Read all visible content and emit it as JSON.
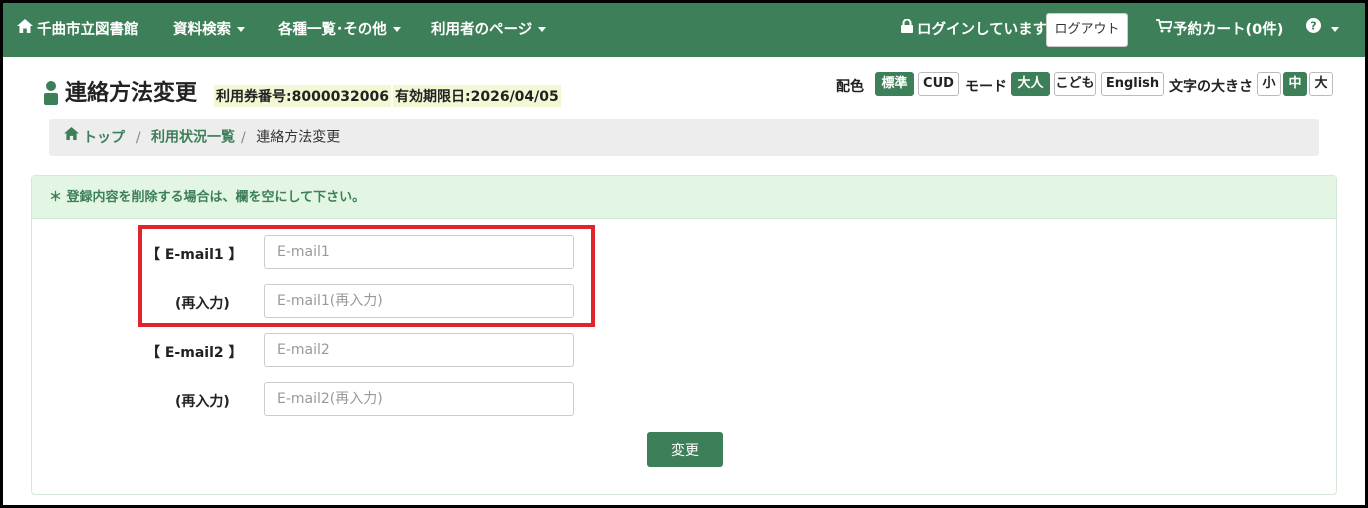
{
  "navbar": {
    "site_name": "千曲市立図書館",
    "menu": [
      "資料検索",
      "各種一覧･その他",
      "利用者のページ"
    ],
    "login_status": "ログインしています",
    "logout_label": "ログアウト",
    "cart_label": "予約カート(0件)",
    "help_icon": "question-circle-icon"
  },
  "header": {
    "title": "連絡方法変更",
    "card_number": "利用券番号:8000032006",
    "expiry": "有効期限日:2026/04/05"
  },
  "toolbar": {
    "color_label": "配色",
    "color_options": [
      "標準",
      "CUD"
    ],
    "mode_label": "モード",
    "mode_options": [
      "大人",
      "こども",
      "English"
    ],
    "size_label": "文字の大きさ",
    "size_options": [
      "小",
      "中",
      "大"
    ]
  },
  "breadcrumb": {
    "home": "トップ",
    "parent": "利用状況一覧",
    "current": "連絡方法変更",
    "separator": "/"
  },
  "panel": {
    "notice": "＊ 登録内容を削除する場合は、欄を空にして下さい。",
    "fields": [
      {
        "label": "【 E-mail1 】",
        "placeholder": "E-mail1",
        "value": ""
      },
      {
        "label": "(再入力)",
        "placeholder": "E-mail1(再入力)",
        "value": ""
      },
      {
        "label": "【 E-mail2 】",
        "placeholder": "E-mail2",
        "value": ""
      },
      {
        "label": "(再入力)",
        "placeholder": "E-mail2(再入力)",
        "value": ""
      }
    ],
    "submit_label": "変更"
  },
  "colors": {
    "brand_green": "#3d7f58",
    "notice_bg": "#e3f6e3",
    "highlight_red": "#e0242c"
  }
}
